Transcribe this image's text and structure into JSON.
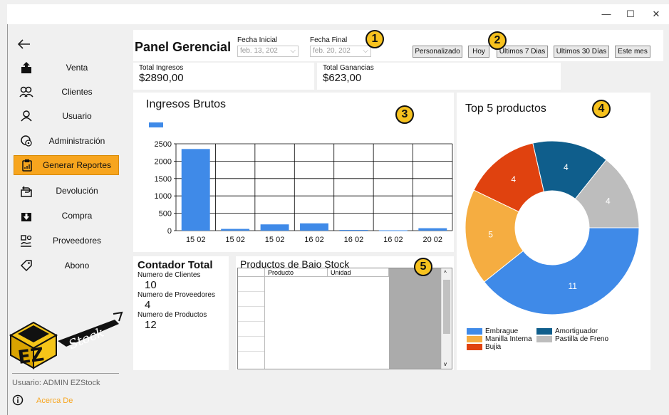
{
  "window": {
    "minimize": "—",
    "maximize": "☐",
    "close": "✕"
  },
  "sidebar": {
    "items": [
      {
        "label": "Venta",
        "icon": "upload-box-icon"
      },
      {
        "label": "Clientes",
        "icon": "users-icon"
      },
      {
        "label": "Usuario",
        "icon": "user-icon"
      },
      {
        "label": "Administración",
        "icon": "admin-gear-icon"
      },
      {
        "label": "Generar Reportes",
        "icon": "report-clipboard-icon",
        "active": true
      },
      {
        "label": "Devolución",
        "icon": "return-box-icon"
      },
      {
        "label": "Compra",
        "icon": "download-box-icon"
      },
      {
        "label": "Proveedores",
        "icon": "suppliers-icon"
      },
      {
        "label": "Abono",
        "icon": "tag-icon"
      }
    ],
    "logo_text": "EZStock",
    "user_label": "Usuario: ADMIN EZStock",
    "about_label": "Acerca De"
  },
  "header": {
    "title": "Panel Gerencial",
    "fecha_inicial_label": "Fecha Inicial",
    "fecha_inicial_value": "feb. 13, 202",
    "fecha_final_label": "Fecha Final",
    "fecha_final_value": "feb. 20, 202",
    "buttons": [
      "Personalizado",
      "Hoy",
      "Ultimos 7 Dias",
      "Ultimos 30 Días",
      "Este mes"
    ]
  },
  "badges": [
    "1",
    "2",
    "3",
    "4",
    "5"
  ],
  "stats": {
    "total_ingresos_label": "Total Ingresos",
    "total_ingresos_value": "$2890,00",
    "total_ganancias_label": "Total Ganancias",
    "total_ganancias_value": "$623,00"
  },
  "counter": {
    "title": "Contador Total",
    "clientes_label": "Numero de Clientes",
    "clientes_value": "10",
    "proveedores_label": "Numero de Proveedores",
    "proveedores_value": "4",
    "productos_label": "Numero de Productos",
    "productos_value": "12"
  },
  "low_stock": {
    "title": "Productos de Bajo Stock",
    "columns": [
      "Producto",
      "Unidad"
    ]
  },
  "chart_data": [
    {
      "type": "bar",
      "title": "Ingresos Brutos",
      "categories": [
        "15 02",
        "15 02",
        "15 02",
        "16 02",
        "16 02",
        "16 02",
        "20 02"
      ],
      "values": [
        2350,
        50,
        180,
        210,
        20,
        10,
        70
      ],
      "ylim": [
        0,
        2500
      ],
      "yticks": [
        0,
        500,
        1000,
        1500,
        2000,
        2500
      ],
      "color": "#3f8ae8",
      "grid": true
    },
    {
      "type": "pie",
      "title": "Top 5 productos",
      "donut": true,
      "slices": [
        {
          "name": "Embrague",
          "value": 11,
          "color": "#3f8ae8"
        },
        {
          "name": "Manilla Interna",
          "value": 5,
          "color": "#f5ad41"
        },
        {
          "name": "Bujia",
          "value": 4,
          "color": "#e0420f"
        },
        {
          "name": "Amortiguador",
          "value": 4,
          "color": "#0f5e8c"
        },
        {
          "name": "Pastilla de Freno",
          "value": 4,
          "color": "#bdbdbd"
        }
      ],
      "legend_placement": "bottom"
    }
  ]
}
